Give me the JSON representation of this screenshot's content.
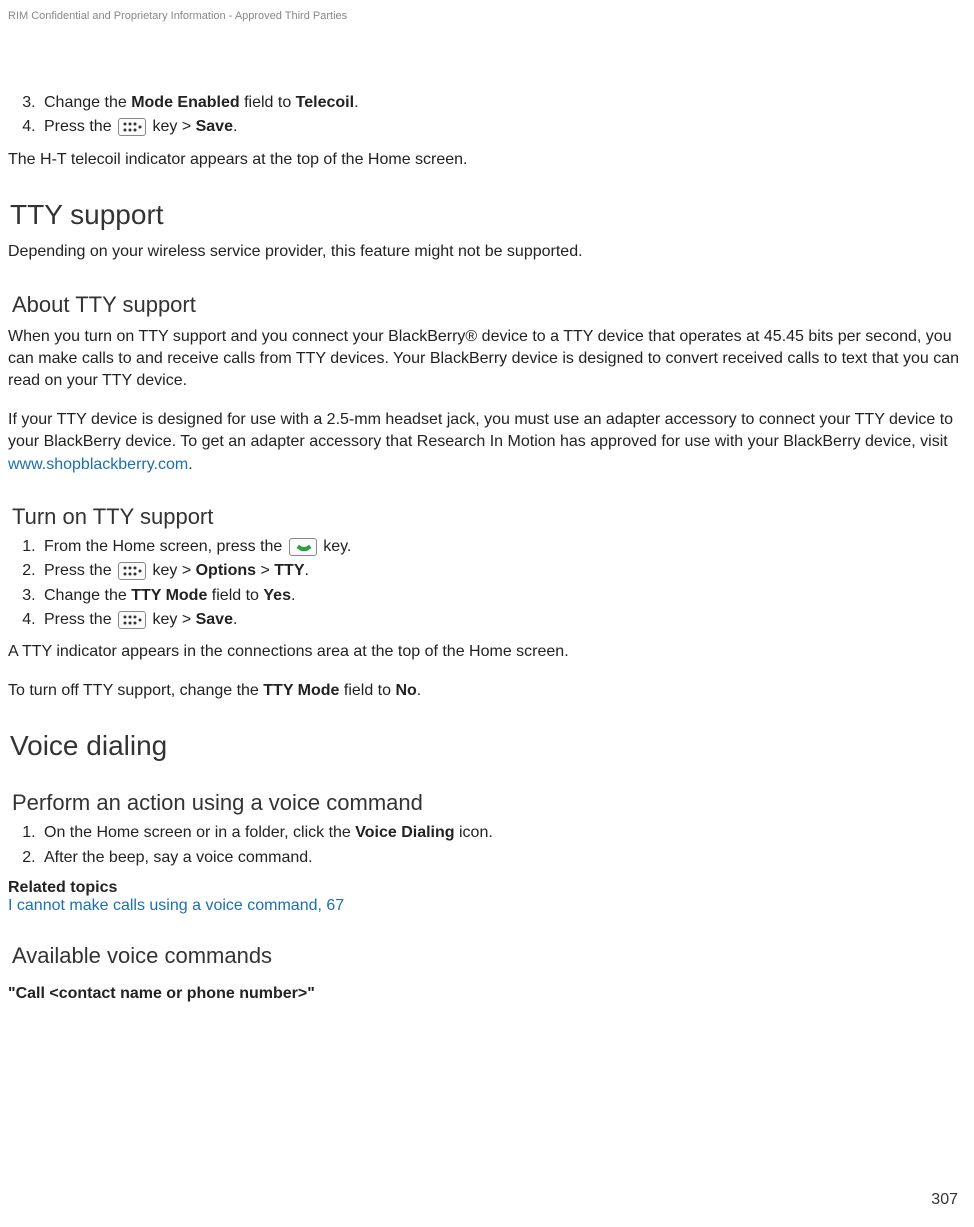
{
  "header_note": "RIM Confidential and Proprietary Information - Approved Third Parties",
  "top_list": {
    "item3": {
      "num": "3.",
      "pre": "Change the ",
      "b1": "Mode Enabled",
      "mid": " field to ",
      "b2": "Telecoil",
      "post": "."
    },
    "item4": {
      "num": "4.",
      "pre": "Press the ",
      "icon": "menu-key-icon",
      "mid": " key > ",
      "b1": "Save",
      "post": "."
    }
  },
  "top_para": "The H-T telecoil indicator appears at the top of the Home screen.",
  "tty": {
    "title": "TTY support",
    "intro": "Depending on your wireless service provider, this feature might not be supported.",
    "about_title": "About TTY support",
    "about_p1": "When you turn on TTY support and you connect your BlackBerry® device to a TTY device that operates at 45.45 bits per second, you can make calls to and receive calls from TTY devices. Your BlackBerry device is designed to convert received calls to text that you can read on your TTY device.",
    "about_p2_pre": "If your TTY device is designed for use with a 2.5-mm headset jack, you must use an adapter accessory to connect your TTY device to your BlackBerry device. To get an adapter accessory that Research In Motion has approved for use with your BlackBerry device, visit ",
    "about_p2_link": "www.shopblackberry.com",
    "about_p2_post": ".",
    "turn_on_title": "Turn on TTY support",
    "steps": {
      "s1": {
        "num": "1.",
        "pre": "From the Home screen, press the ",
        "icon": "call-key-icon",
        "post": " key."
      },
      "s2": {
        "num": "2.",
        "pre": "Press the ",
        "icon": "menu-key-icon",
        "mid": " key > ",
        "b1": "Options",
        "mid2": " > ",
        "b2": "TTY",
        "post": "."
      },
      "s3": {
        "num": "3.",
        "pre": "Change the ",
        "b1": "TTY Mode",
        "mid": " field to ",
        "b2": "Yes",
        "post": "."
      },
      "s4": {
        "num": "4.",
        "pre": "Press the ",
        "icon": "menu-key-icon",
        "mid": " key > ",
        "b1": "Save",
        "post": "."
      }
    },
    "after1": "A TTY indicator appears in the connections area at the top of the Home screen.",
    "after2_pre": "To turn off TTY support, change the ",
    "after2_b1": "TTY Mode",
    "after2_mid": " field to ",
    "after2_b2": "No",
    "after2_post": "."
  },
  "voice": {
    "title": "Voice dialing",
    "perform_title": "Perform an action using a voice command",
    "steps": {
      "s1": {
        "num": "1.",
        "pre": "On the Home screen or in a folder, click the ",
        "b1": "Voice Dialing",
        "post": " icon."
      },
      "s2": {
        "num": "2.",
        "text": "After the beep, say a voice command."
      }
    },
    "related_head": "Related topics",
    "related_link": "I cannot make calls using a voice command, 67",
    "avail_title": "Available voice commands",
    "command1": "\"Call <contact name or phone number>\""
  },
  "page_number": "307"
}
